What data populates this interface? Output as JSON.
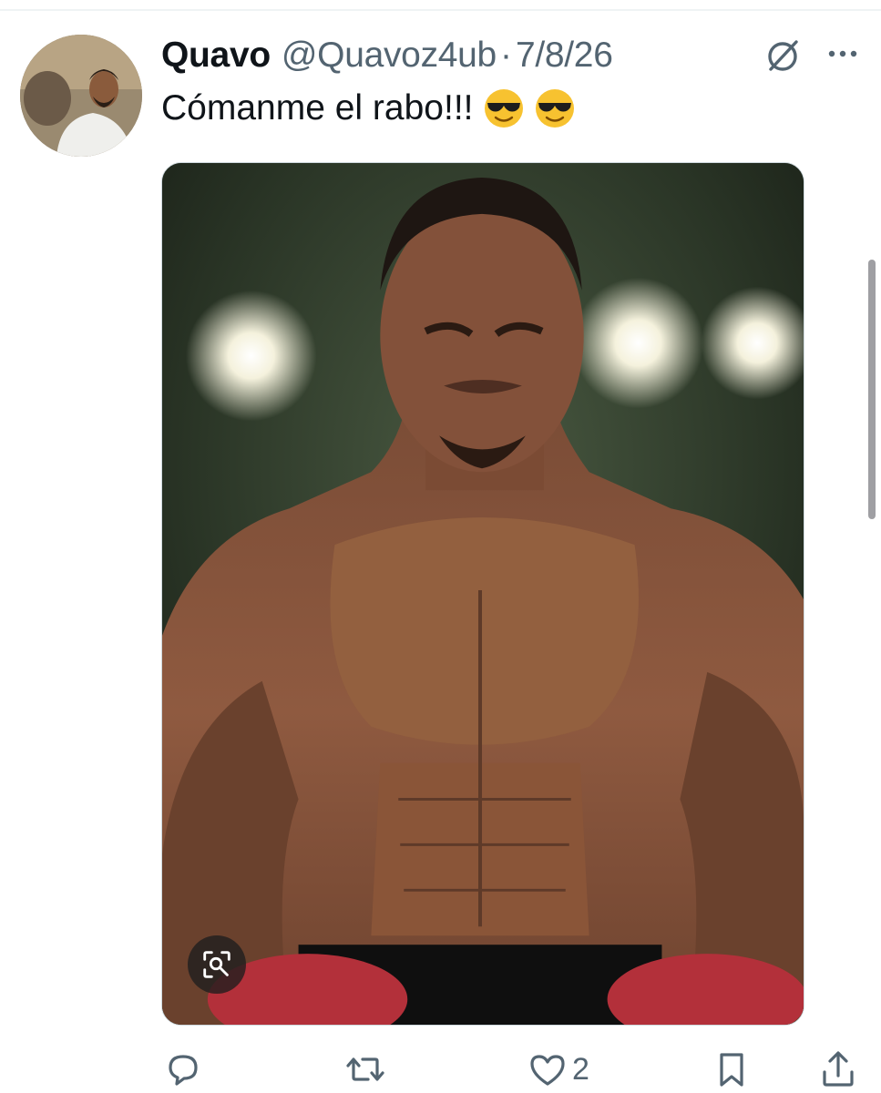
{
  "tweet": {
    "display_name": "Quavo",
    "handle": "@Quavoz4ub",
    "separator": "·",
    "date": "7/8/26",
    "text": "Cómanme el rabo!!!",
    "emojis": [
      "smiling-face-with-sunglasses",
      "smiling-face-with-sunglasses"
    ]
  },
  "actions": {
    "reply_count": "",
    "repost_count": "",
    "like_count": "2",
    "bookmark_count": "",
    "share_count": ""
  },
  "icons": {
    "grok": "grok-icon",
    "more": "more-horizontal-icon",
    "reply": "reply-icon",
    "repost": "repost-icon",
    "like": "heart-icon",
    "bookmark": "bookmark-icon",
    "share": "share-icon",
    "lens": "visual-search-icon"
  },
  "colors": {
    "text": "#0f1419",
    "secondary": "#536471",
    "divider": "#eff3f4"
  }
}
